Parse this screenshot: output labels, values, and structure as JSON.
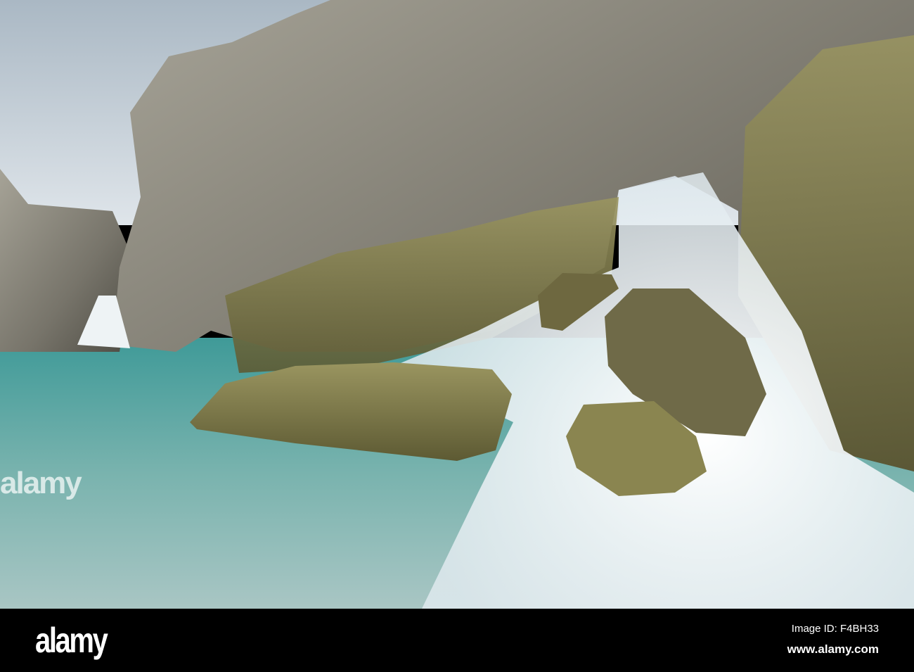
{
  "photo": {
    "subject": "waterfall",
    "colors": {
      "sky": "#c9d2da",
      "rock": "#8a877c",
      "moss": "#7a8a3a",
      "water": "#5fa7a6",
      "foam": "#f2f5f7"
    }
  },
  "watermark": {
    "brand": "alamy",
    "image_id": "Image ID: F4BH33",
    "url": "www.alamy.com"
  }
}
